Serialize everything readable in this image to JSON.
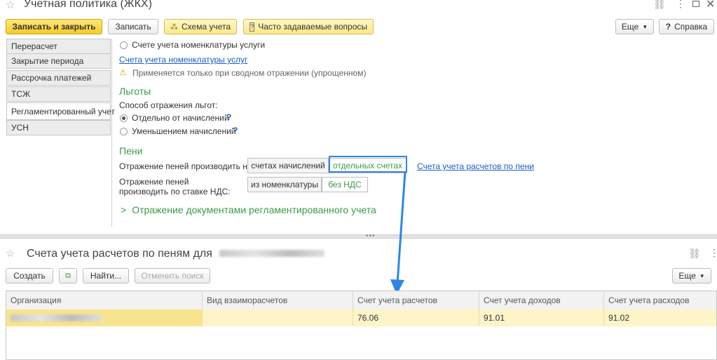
{
  "top_window": {
    "title": "Учетная политика (ЖКХ)",
    "toolbar": {
      "save_close": "Записать и закрыть",
      "save": "Записать",
      "scheme": "Схема учета",
      "faq": "Часто задаваемые вопросы",
      "more": "Еще",
      "help": "Справка"
    },
    "sidebar": [
      {
        "label": "Перерасчет"
      },
      {
        "label": "Закрытие периода"
      },
      {
        "label": "Рассрочка платежей"
      },
      {
        "label": "ТСЖ"
      },
      {
        "label": "Регламентированный учет"
      },
      {
        "label": "УСН"
      }
    ],
    "content": {
      "radio_services_account": "Счете учета номенклатуры услуги",
      "link_services_accounts": "Счета учета номенклатуры услуг",
      "warning_text": "Применяется только при сводном отражении (упрощенном)",
      "benefits_heading": "Льготы",
      "benefits_method_label": "Способ отражения льгот:",
      "benefits_options": [
        "Отдельно от начислений",
        "Уменьшением начислений"
      ],
      "help_mark": "?",
      "penalties_heading": "Пени",
      "penalties_reflect_label": "Отражение пеней производить на:",
      "penalties_reflect_options": [
        "счетах начислений",
        "отдельных счетах"
      ],
      "penalties_accounts_link": "Счета учета расчетов по пени",
      "penalties_vat_label_1": "Отражение пеней",
      "penalties_vat_label_2": "производить по ставке НДС:",
      "penalties_vat_options": [
        "из номенклатуры",
        "без НДС"
      ],
      "reg_docs_group": "Отражение документами регламентированного учета"
    }
  },
  "bottom_window": {
    "title": "Счета учета расчетов по пеням для",
    "toolbar": {
      "create": "Создать",
      "find": "Найти...",
      "cancel_search": "Отменить поиск",
      "more": "Еще"
    },
    "table": {
      "columns": [
        "Организация",
        "Вид взаиморасчетов",
        "Счет учета расчетов",
        "Счет учета доходов",
        "Счет учета расходов"
      ],
      "rows": [
        {
          "vid": "",
          "settlement": "76.06",
          "income": "91.01",
          "expense": "91.02"
        }
      ]
    }
  },
  "colors": {
    "accent_yellow": "#f7c928",
    "green_text": "#3c9a47",
    "link_blue": "#1a5ec7",
    "highlight_blue": "#2f86e6",
    "selected_row": "#fdf4c8"
  }
}
